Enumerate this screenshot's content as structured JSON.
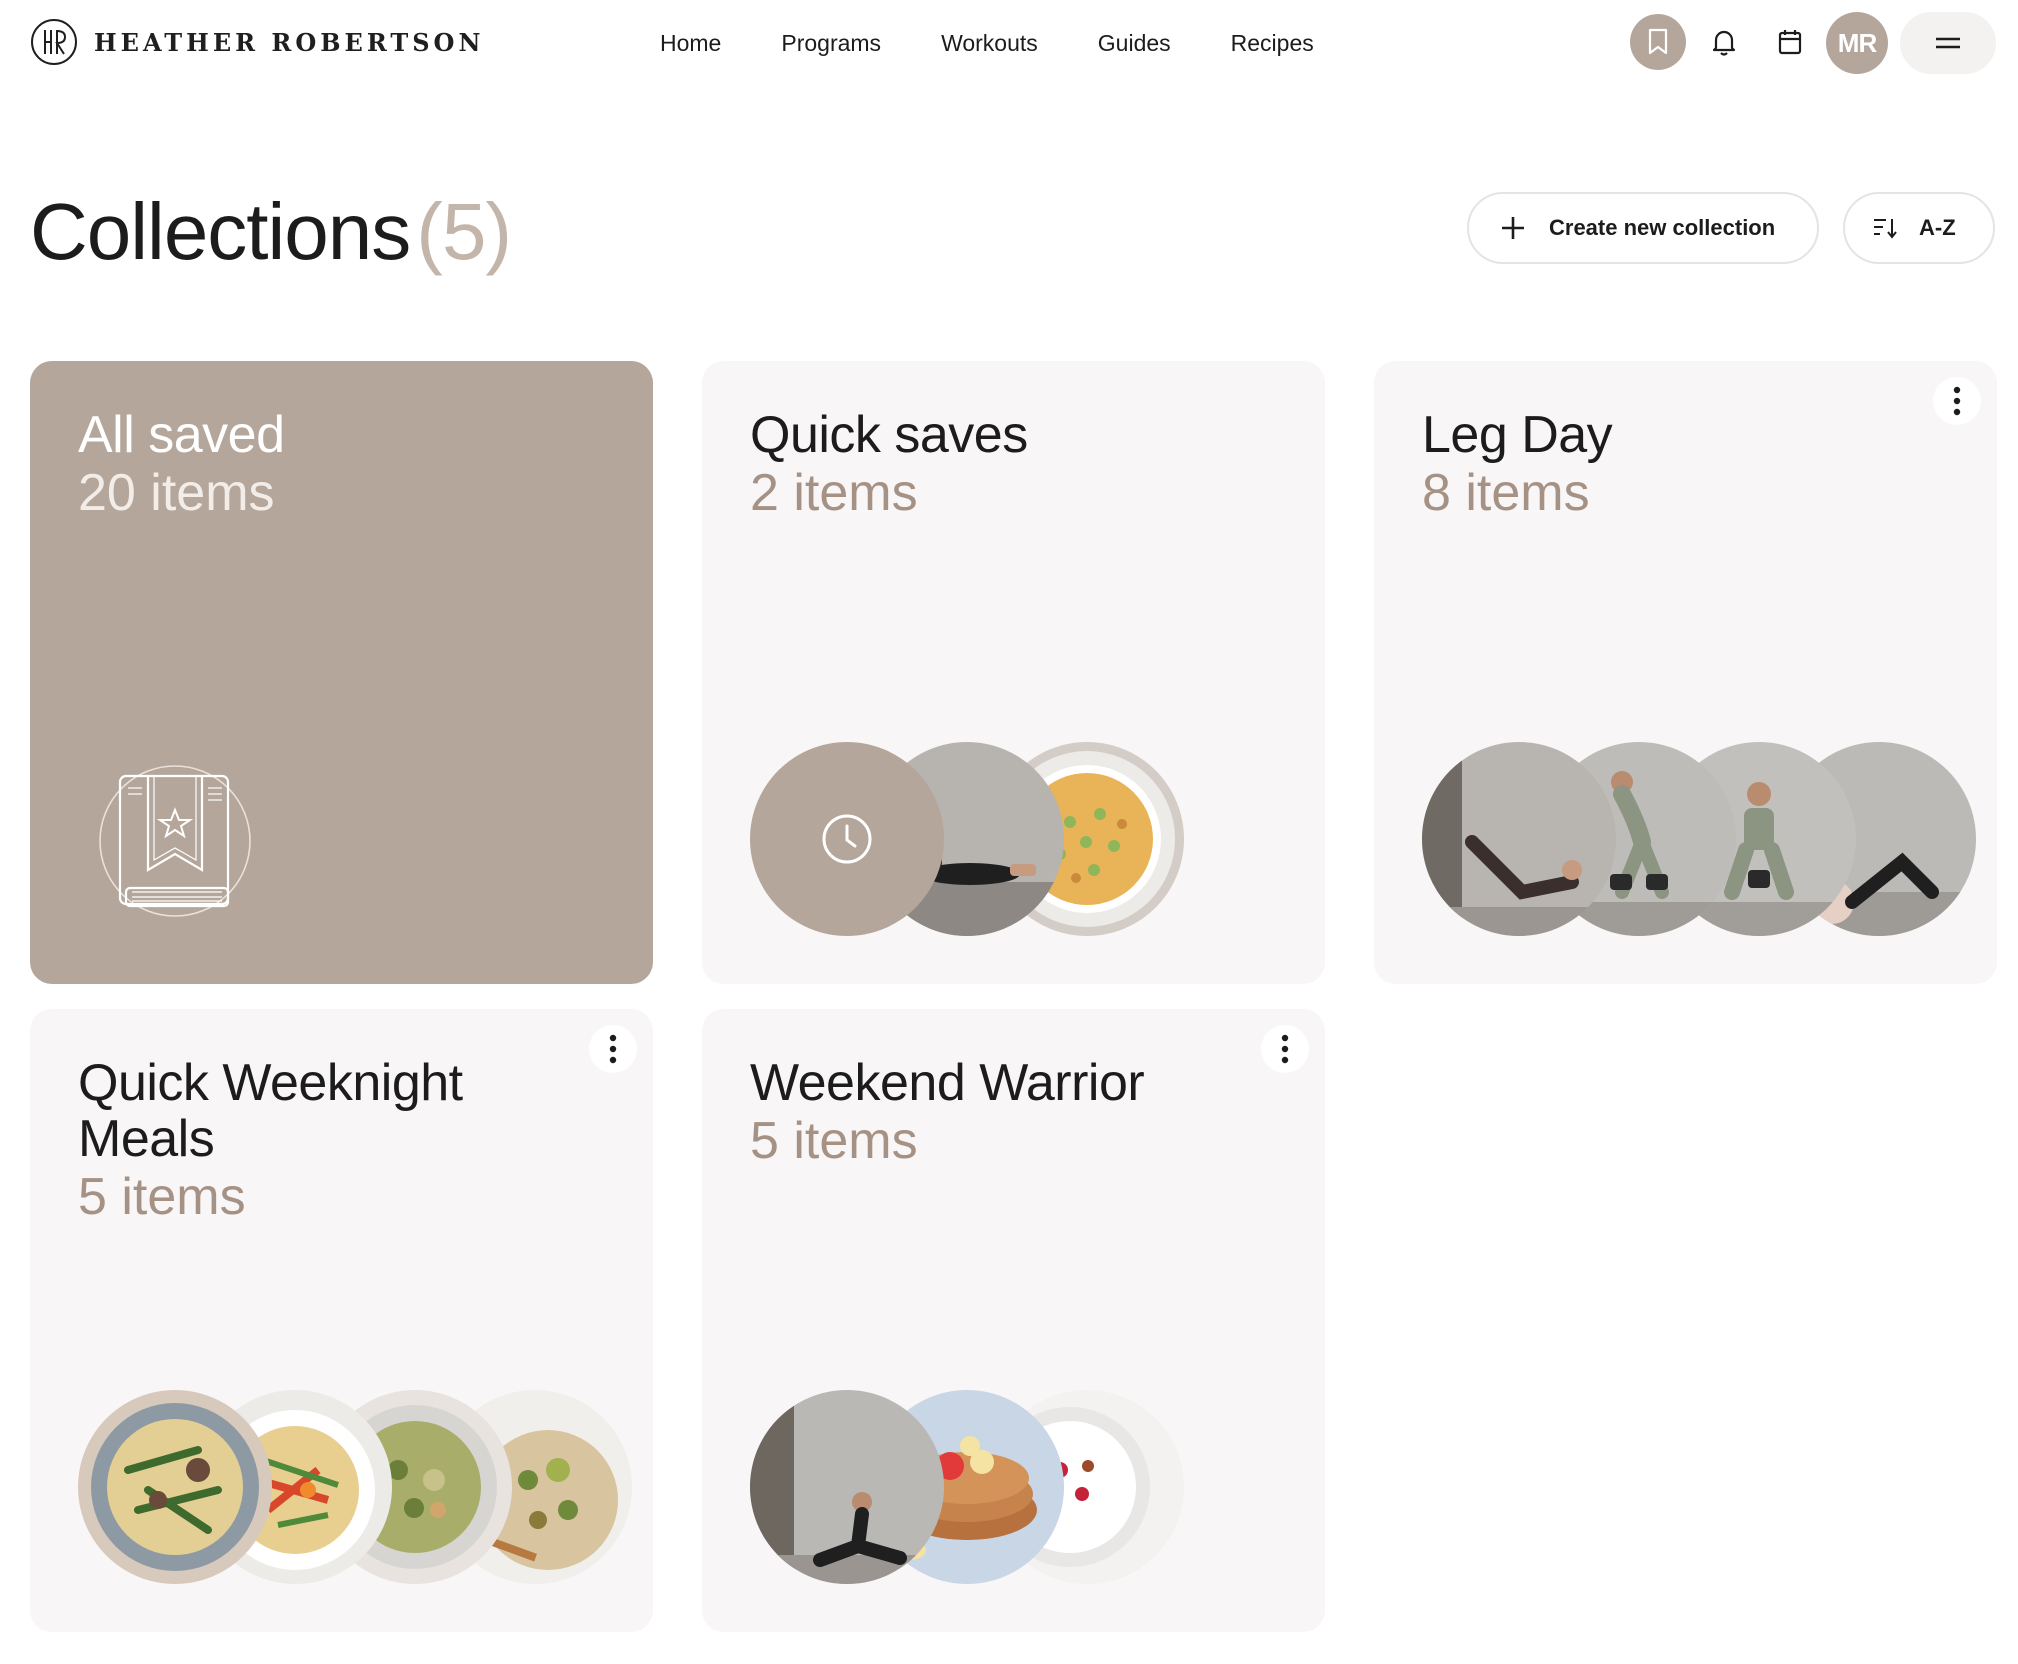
{
  "brand": {
    "name": "HEATHER ROBERTSON",
    "logo_icon": "hr-monogram-logo"
  },
  "nav": {
    "items": [
      {
        "label": "Home"
      },
      {
        "label": "Programs"
      },
      {
        "label": "Workouts"
      },
      {
        "label": "Guides"
      },
      {
        "label": "Recipes"
      }
    ]
  },
  "header_icons": {
    "bookmark": "bookmark-icon",
    "bell": "bell-icon",
    "calendar": "calendar-icon",
    "avatar_initials": "MR",
    "menu": "menu-icon"
  },
  "page": {
    "title": "Collections",
    "count": "(5)",
    "create_label": "Create new collection",
    "sort_label": "A-Z"
  },
  "colors": {
    "accent": "#b5a69b",
    "card_bg": "#f8f6f6",
    "count_text": "#a69284"
  },
  "collections": [
    {
      "title": "All saved",
      "count": "20 items",
      "thumbs": [
        "bookmark-book-illustration"
      ]
    },
    {
      "title": "Quick saves",
      "count": "2 items",
      "thumbs": [
        "clock-icon",
        "workout-photo",
        "frittata-photo"
      ]
    },
    {
      "title": "Leg Day",
      "count": "8 items",
      "thumbs": [
        "workout-photo",
        "workout-photo",
        "workout-photo",
        "workout-photo"
      ]
    },
    {
      "title": "Quick Weeknight Meals",
      "count": "5 items",
      "thumbs": [
        "pasta-photo",
        "noodles-photo",
        "salad-photo",
        "grain-bowl-photo"
      ]
    },
    {
      "title": "Weekend Warrior",
      "count": "5 items",
      "thumbs": [
        "workout-photo",
        "pancakes-photo",
        "yogurt-photo"
      ]
    }
  ]
}
